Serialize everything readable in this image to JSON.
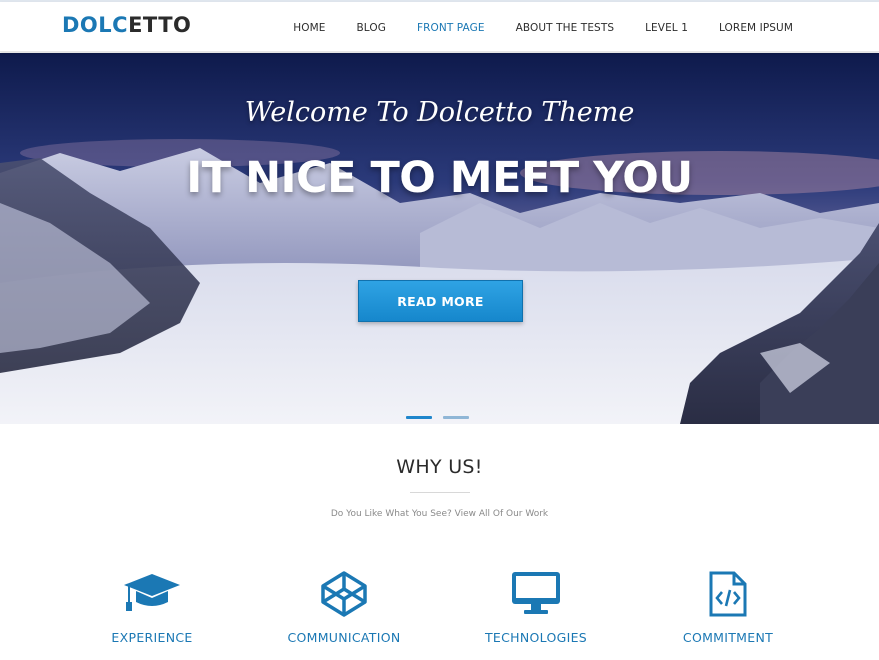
{
  "brand": {
    "part1": "DOLC",
    "part2": "ETTO"
  },
  "nav": {
    "items": [
      {
        "label": "HOME",
        "active": false
      },
      {
        "label": "BLOG",
        "active": false
      },
      {
        "label": "FRONT PAGE",
        "active": true
      },
      {
        "label": "ABOUT THE TESTS",
        "active": false
      },
      {
        "label": "LEVEL 1",
        "active": false
      },
      {
        "label": "LOREM IPSUM",
        "active": false
      }
    ]
  },
  "hero": {
    "subtitle": "Welcome To Dolcetto Theme",
    "title": "IT NICE TO MEET YOU",
    "button": "READ MORE",
    "slides": {
      "count": 2,
      "active": 1
    }
  },
  "why": {
    "title": "WHY US!",
    "subtitle": "Do You Like What You See? View All Of Our Work"
  },
  "features": [
    {
      "label": "EXPERIENCE",
      "icon": "graduation-cap-icon"
    },
    {
      "label": "COMMUNICATION",
      "icon": "codepen-icon"
    },
    {
      "label": "TECHNOLOGIES",
      "icon": "desktop-icon"
    },
    {
      "label": "COMMITMENT",
      "icon": "code-file-icon"
    }
  ],
  "colors": {
    "accent": "#1b78b4",
    "button": "#1e8fd5"
  }
}
